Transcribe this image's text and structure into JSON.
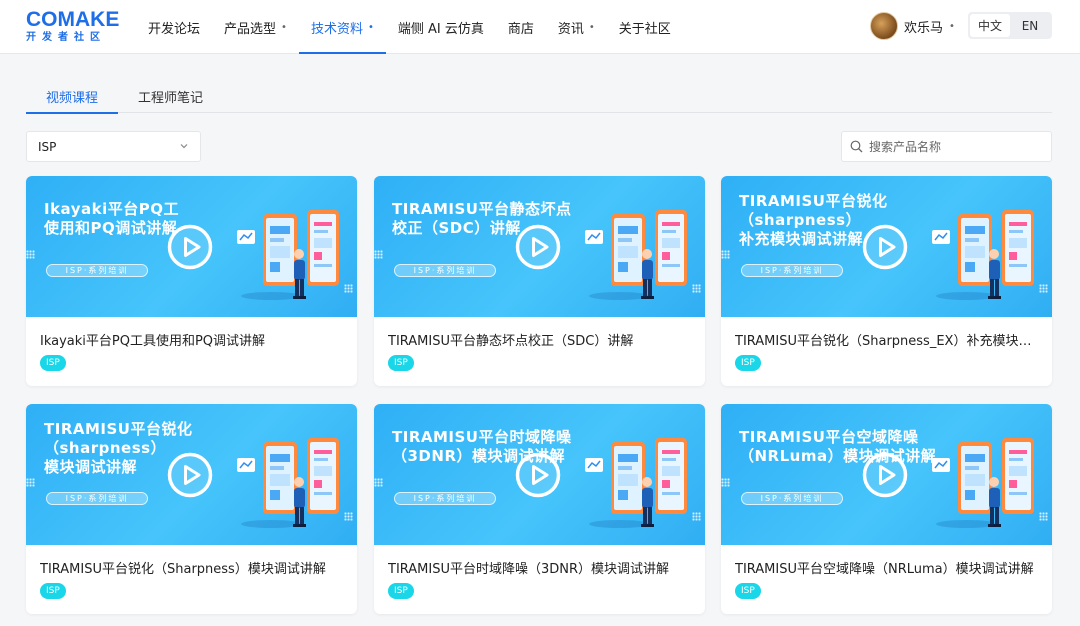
{
  "brand": {
    "logo_text": "COMAKE",
    "logo_sub": "开发者社区",
    "accent": "#1e6ee8"
  },
  "nav": {
    "items": [
      {
        "label": "开发论坛",
        "has_dropdown": false,
        "active": false
      },
      {
        "label": "产品选型",
        "has_dropdown": true,
        "active": false
      },
      {
        "label": "技术资料",
        "has_dropdown": true,
        "active": true
      },
      {
        "label": "端侧 AI 云仿真",
        "has_dropdown": false,
        "active": false
      },
      {
        "label": "商店",
        "has_dropdown": false,
        "active": false
      },
      {
        "label": "资讯",
        "has_dropdown": true,
        "active": false
      },
      {
        "label": "关于社区",
        "has_dropdown": false,
        "active": false
      }
    ]
  },
  "user": {
    "name": "欢乐马"
  },
  "lang": {
    "options": [
      "中文",
      "EN"
    ],
    "selected": "中文"
  },
  "tabs": [
    {
      "label": "视频课程",
      "active": true
    },
    {
      "label": "工程师笔记",
      "active": false
    }
  ],
  "filter": {
    "selected": "ISP"
  },
  "search": {
    "placeholder": "搜索产品名称"
  },
  "cards": [
    {
      "thumb_lines": [
        "Ikayaki平台PQ工",
        "使用和PQ调试讲解"
      ],
      "thumb_badge": "ISP·系列培训",
      "title": "Ikayaki平台PQ工具使用和PQ调试讲解",
      "tag": "ISP"
    },
    {
      "thumb_lines": [
        "TIRAMISU平台静态坏点",
        "校正（SDC）讲解"
      ],
      "thumb_badge": "ISP·系列培训",
      "title": "TIRAMISU平台静态坏点校正（SDC）讲解",
      "tag": "ISP"
    },
    {
      "thumb_lines": [
        "TIRAMISU平台锐化",
        "（sharpness）",
        "补充模块调试讲解"
      ],
      "thumb_badge": "ISP·系列培训",
      "title": "TIRAMISU平台锐化（Sharpness_EX）补充模块调试讲解",
      "tag": "ISP"
    },
    {
      "thumb_lines": [
        "TIRAMISU平台锐化",
        "（sharpness）",
        "模块调试讲解"
      ],
      "thumb_badge": "ISP·系列培训",
      "title": "TIRAMISU平台锐化（Sharpness）模块调试讲解",
      "tag": "ISP"
    },
    {
      "thumb_lines": [
        "TIRAMISU平台时域降噪",
        "（3DNR）模块调试讲解"
      ],
      "thumb_badge": "ISP·系列培训",
      "title": "TIRAMISU平台时域降噪（3DNR）模块调试讲解",
      "tag": "ISP"
    },
    {
      "thumb_lines": [
        "TIRAMISU平台空域降噪",
        "（NRLuma）模块调试讲解"
      ],
      "thumb_badge": "ISP·系列培训",
      "title": "TIRAMISU平台空域降噪（NRLuma）模块调试讲解",
      "tag": "ISP"
    }
  ]
}
